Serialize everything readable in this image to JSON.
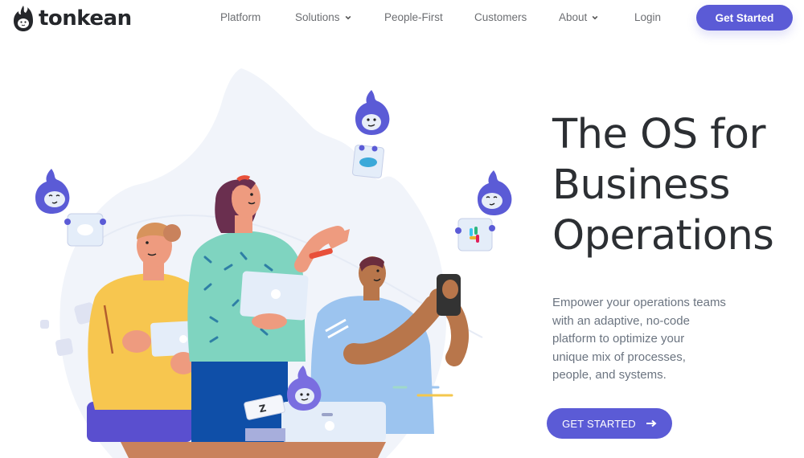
{
  "brand": {
    "name": "tonkean",
    "accent_color": "#5b5bd6",
    "text_color": "#2c2f33"
  },
  "nav": {
    "items": [
      {
        "label": "Platform",
        "has_dropdown": false
      },
      {
        "label": "Solutions",
        "has_dropdown": true
      },
      {
        "label": "People-First",
        "has_dropdown": false
      },
      {
        "label": "Customers",
        "has_dropdown": false
      },
      {
        "label": "About",
        "has_dropdown": true
      },
      {
        "label": "Login",
        "has_dropdown": false
      }
    ],
    "cta_label": "Get Started"
  },
  "hero": {
    "title_lines": [
      "The OS for",
      "Business",
      "Operations"
    ],
    "subtitle_lines": [
      "Empower your operations teams",
      "with an adaptive, no-code",
      "platform to optimize your",
      "unique mix of processes,",
      "people, and systems."
    ],
    "cta_label": "GET STARTED",
    "cta_icon": "arrow-right-icon"
  },
  "illustration": {
    "description": "Three people with tablets and phone, surrounded by purple mascots holding integration cards",
    "integration_cards": [
      "chat-icon",
      "salesforce-icon",
      "slack-icon",
      "zendesk-icon"
    ],
    "mascot_icon": "tonkean-mascot-icon"
  }
}
